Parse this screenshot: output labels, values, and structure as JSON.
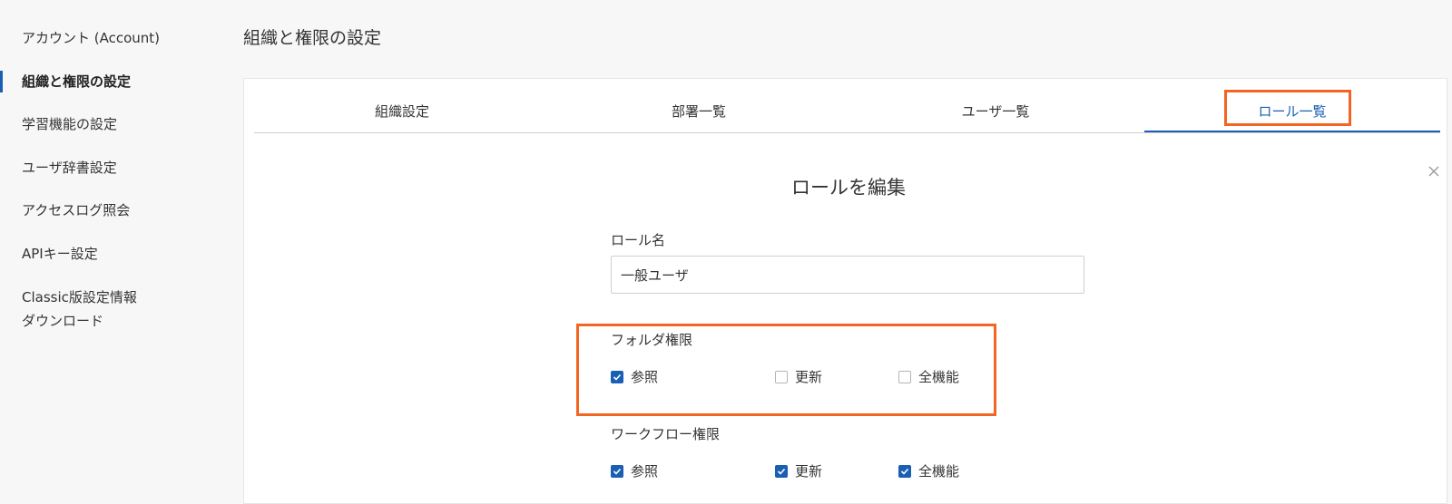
{
  "sidebar": {
    "items": [
      {
        "label": "アカウント (Account)"
      },
      {
        "label": "組織と権限の設定"
      },
      {
        "label": "学習機能の設定"
      },
      {
        "label": "ユーザ辞書設定"
      },
      {
        "label": "アクセスログ照会"
      },
      {
        "label": "APIキー設定"
      },
      {
        "label": "Classic版設定情報"
      },
      {
        "label": "ダウンロード"
      }
    ]
  },
  "page": {
    "title": "組織と権限の設定"
  },
  "tabs": [
    {
      "label": "組織設定"
    },
    {
      "label": "部署一覧"
    },
    {
      "label": "ユーザ一覧"
    },
    {
      "label": "ロール一覧"
    }
  ],
  "dialog": {
    "title": "ロールを編集",
    "role_name_label": "ロール名",
    "role_name_value": "一般ユーザ",
    "folder": {
      "label": "フォルダ権限",
      "options": [
        {
          "label": "参照",
          "checked": true
        },
        {
          "label": "更新",
          "checked": false
        },
        {
          "label": "全機能",
          "checked": false
        }
      ]
    },
    "workflow": {
      "label": "ワークフロー権限",
      "options": [
        {
          "label": "参照",
          "checked": true
        },
        {
          "label": "更新",
          "checked": true
        },
        {
          "label": "全機能",
          "checked": true
        }
      ]
    }
  },
  "colors": {
    "accent": "#1a5fb4",
    "highlight": "#f26522"
  }
}
